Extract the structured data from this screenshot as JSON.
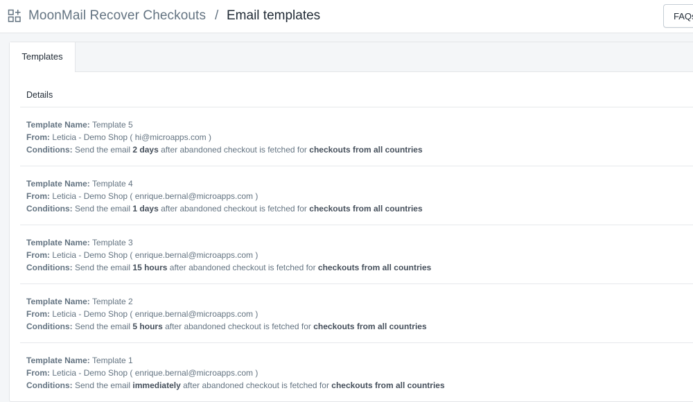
{
  "header": {
    "app_name": "MoonMail Recover Checkouts",
    "separator": "/",
    "page_title": "Email templates",
    "faq_label": "FAQs"
  },
  "tabs": [
    {
      "label": "Templates"
    }
  ],
  "section": {
    "title": "Details"
  },
  "labels": {
    "template_name": "Template Name:",
    "from": "From:",
    "conditions": "Conditions:",
    "cond_prefix": "Send the email",
    "cond_middle": "after abandoned checkout is fetched for",
    "cond_target": "checkouts from all countries"
  },
  "templates": [
    {
      "name": "Template 5",
      "from": "Leticia - Demo Shop ( hi@microapps.com )",
      "delay": "2 days"
    },
    {
      "name": "Template 4",
      "from": "Leticia - Demo Shop ( enrique.bernal@microapps.com )",
      "delay": "1 days"
    },
    {
      "name": "Template 3",
      "from": "Leticia - Demo Shop ( enrique.bernal@microapps.com )",
      "delay": "15 hours"
    },
    {
      "name": "Template 2",
      "from": "Leticia - Demo Shop ( enrique.bernal@microapps.com )",
      "delay": "5 hours"
    },
    {
      "name": "Template 1",
      "from": "Leticia - Demo Shop ( enrique.bernal@microapps.com )",
      "delay": "immediately"
    }
  ]
}
